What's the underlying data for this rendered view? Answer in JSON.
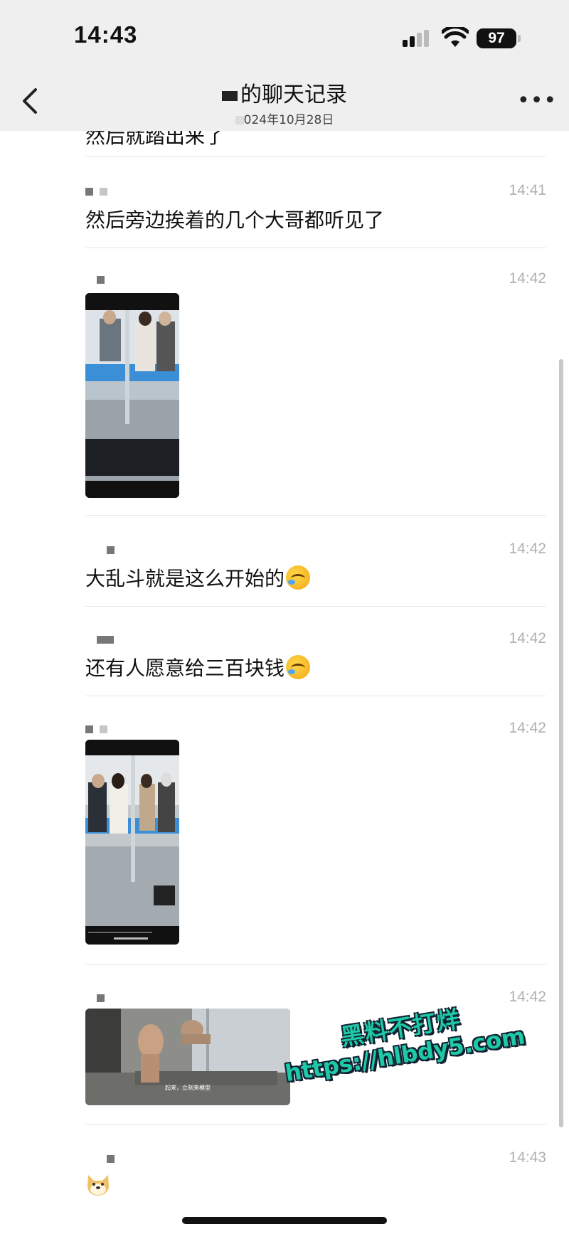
{
  "status_bar": {
    "time": "14:43",
    "battery": "97"
  },
  "header": {
    "title": "的聊天记录",
    "date": "024年10月28日"
  },
  "messages": [
    {
      "clipped_text": "然后就踏出来了"
    },
    {
      "time": "14:41",
      "text": "然后旁边挨着的几个大哥都听见了"
    },
    {
      "time": "14:42",
      "type": "video"
    },
    {
      "time": "14:42",
      "text": "大乱斗就是这么开始的",
      "emoji": "crying-laughing-emoji"
    },
    {
      "time": "14:42",
      "text": "还有人愿意给三百块钱",
      "emoji": "crying-laughing-emoji"
    },
    {
      "time": "14:42",
      "type": "video"
    },
    {
      "time": "14:42",
      "type": "video",
      "caption": "起来，立刻来模型"
    },
    {
      "time": "14:43",
      "emoji": "doge-emoji"
    }
  ],
  "watermark": {
    "line1": "黑料不打烊",
    "line2": "https://hlbdy5.com"
  }
}
